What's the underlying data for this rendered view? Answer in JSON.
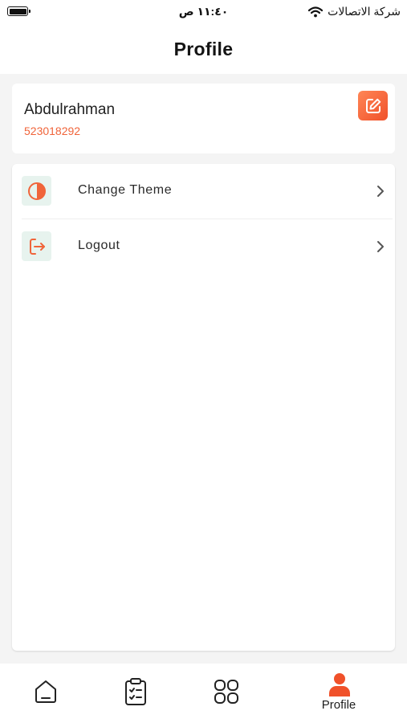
{
  "status_bar": {
    "time": "١١:٤٠ ص",
    "carrier": "شركة الاتصالات"
  },
  "header": {
    "title": "Profile"
  },
  "user": {
    "name": "Abdulrahman",
    "phone": "523018292"
  },
  "menu": {
    "items": [
      {
        "label": "Change Theme",
        "icon": "theme-contrast-icon"
      },
      {
        "label": "Logout",
        "icon": "logout-icon"
      }
    ]
  },
  "bottom_nav": {
    "items": [
      {
        "label": "",
        "icon": "home-icon"
      },
      {
        "label": "",
        "icon": "clipboard-checklist-icon"
      },
      {
        "label": "",
        "icon": "grid-apps-icon"
      },
      {
        "label": "Profile",
        "icon": "user-icon",
        "active": true
      }
    ]
  },
  "colors": {
    "accent": "#f0643a",
    "icon_tile": "#e7f3ee",
    "background": "#f4f4f4",
    "card": "#ffffff"
  }
}
